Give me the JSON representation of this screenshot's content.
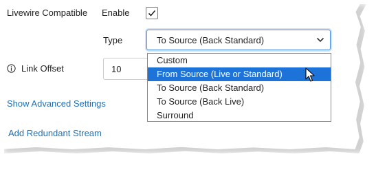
{
  "fields": {
    "livewire_label": "Livewire Compatible",
    "enable_label": "Enable",
    "enable_checked": true,
    "type_label": "Type",
    "type_value": "To Source (Back Standard)",
    "link_offset_label": "Link Offset",
    "link_offset_value": "10"
  },
  "links": {
    "advanced": "Show Advanced Settings",
    "redundant": "Add Redundant Stream"
  },
  "dropdown": {
    "options": [
      "Custom",
      "From Source (Live or Standard)",
      "To Source (Back Standard)",
      "To Source (Back Live)",
      "Surround"
    ],
    "highlighted_index": 1
  },
  "colors": {
    "highlight": "#1e73d8",
    "link": "#1f6fb5",
    "focus_border": "#4a90e2"
  },
  "icons": {
    "check": "check-icon",
    "info": "info-icon",
    "chevron": "chevron-down-icon",
    "cursor": "mouse-pointer-icon"
  }
}
